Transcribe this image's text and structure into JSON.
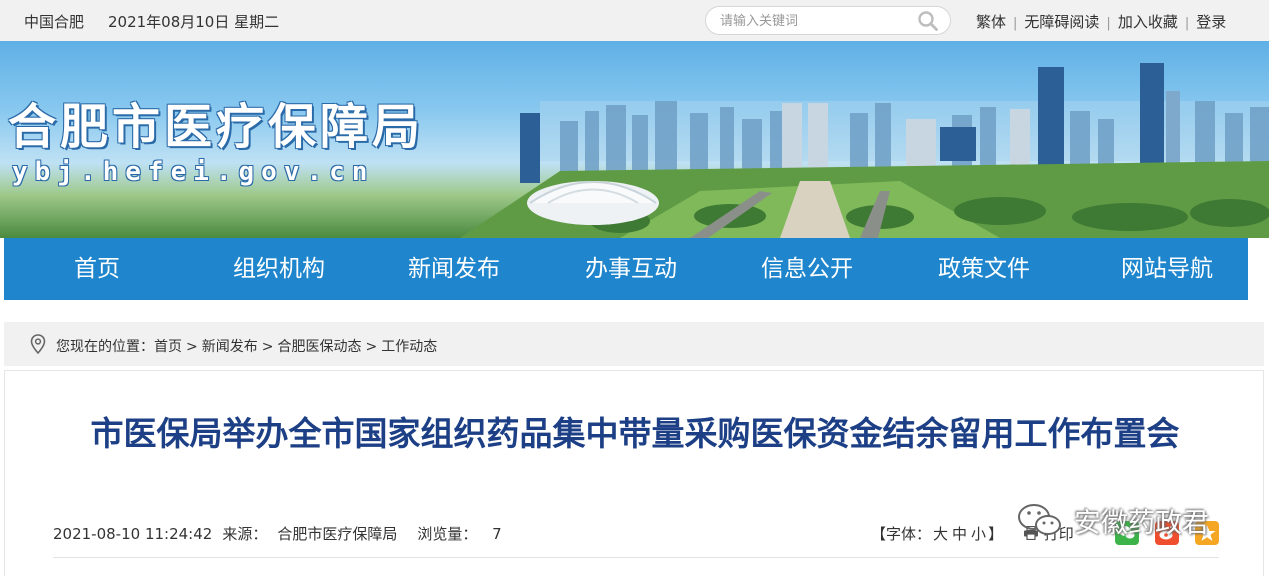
{
  "topbar": {
    "city": "中国合肥",
    "date": "2021年08月10日 星期二",
    "search_placeholder": "请输入关键词",
    "links": [
      "繁体",
      "无障碍阅读",
      "加入收藏",
      "登录"
    ]
  },
  "banner": {
    "title": "合肥市医疗保障局",
    "url": "ybj.hefei.gov.cn"
  },
  "nav": {
    "items": [
      "首页",
      "组织机构",
      "新闻发布",
      "办事互动",
      "信息公开",
      "政策文件",
      "网站导航"
    ]
  },
  "breadcrumb": {
    "prefix": "您现在的位置：",
    "items": [
      "首页",
      "新闻发布",
      "合肥医保动态",
      "工作动态"
    ],
    "separator": ">"
  },
  "article": {
    "title": "市医保局举办全市国家组织药品集中带量采购医保资金结余留用工作布置会",
    "datetime": "2021-08-10 11:24:42",
    "source_label": "来源：",
    "source": "合肥市医疗保障局",
    "views_label": "浏览量：",
    "views": "7",
    "font_label": "【字体：",
    "font_sizes": [
      "大",
      "中",
      "小"
    ],
    "font_close": "】",
    "print_label": "打印"
  },
  "watermark": {
    "text": "安徽药政君"
  },
  "colors": {
    "nav_bg": "#1f86cd",
    "title": "#1c3f86",
    "topbar_bg": "#f1f1f1",
    "wechat": "#3cb44a",
    "weibo": "#ef4f2f",
    "qzone": "#f5a623"
  },
  "icons": [
    "search-icon",
    "location-pin-icon",
    "print-icon",
    "wechat-share-icon",
    "weibo-share-icon",
    "qzone-share-icon"
  ]
}
